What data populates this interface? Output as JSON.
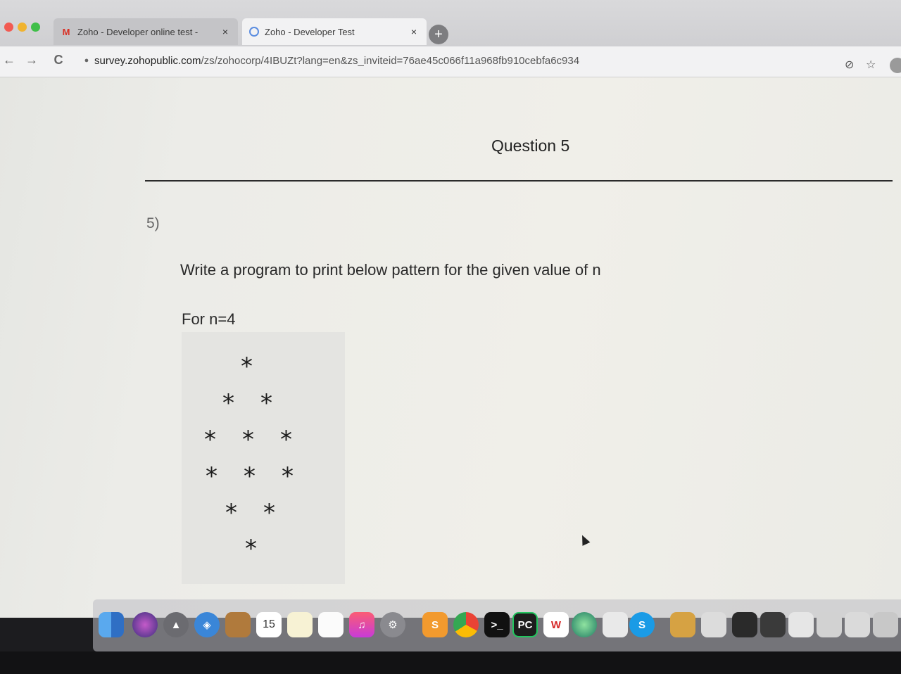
{
  "browser": {
    "tabs": [
      {
        "title": "Zoho - Developer online test -",
        "favicon": "gmail-icon"
      },
      {
        "title": "Zoho - Developer Test",
        "favicon": "zoho-icon"
      }
    ],
    "close_glyph": "×",
    "new_tab_glyph": "+",
    "url_host": "survey.zohopublic.com",
    "url_path": "/zs/zohocorp/4IBUZt?lang=en&zs_inviteid=76ae45c066f11a968fb910cebfa6c934",
    "back_glyph": "←",
    "forward_glyph": "→",
    "reload_glyph": "C",
    "star_glyph": "☆"
  },
  "question": {
    "title": "Question 5",
    "number": "5)",
    "prompt": "Write a program to print below pattern for the given value of n",
    "example_label": "For n=4",
    "pattern_rows": [
      [
        "*"
      ],
      [
        "*",
        "*"
      ],
      [
        "*",
        "*",
        "*"
      ],
      [
        "*",
        "*",
        "*"
      ],
      [
        "*",
        "*"
      ],
      [
        "*"
      ]
    ]
  },
  "dock": {
    "calendar_day": "15",
    "pycharm_label": "PC",
    "wps_label": "W",
    "skype_label": "S",
    "sublime_label": "S"
  },
  "colors": {
    "traffic_red": "#f25a52",
    "traffic_yellow": "#f0b32f",
    "traffic_green": "#3fbf49",
    "text_dark": "#222222"
  }
}
